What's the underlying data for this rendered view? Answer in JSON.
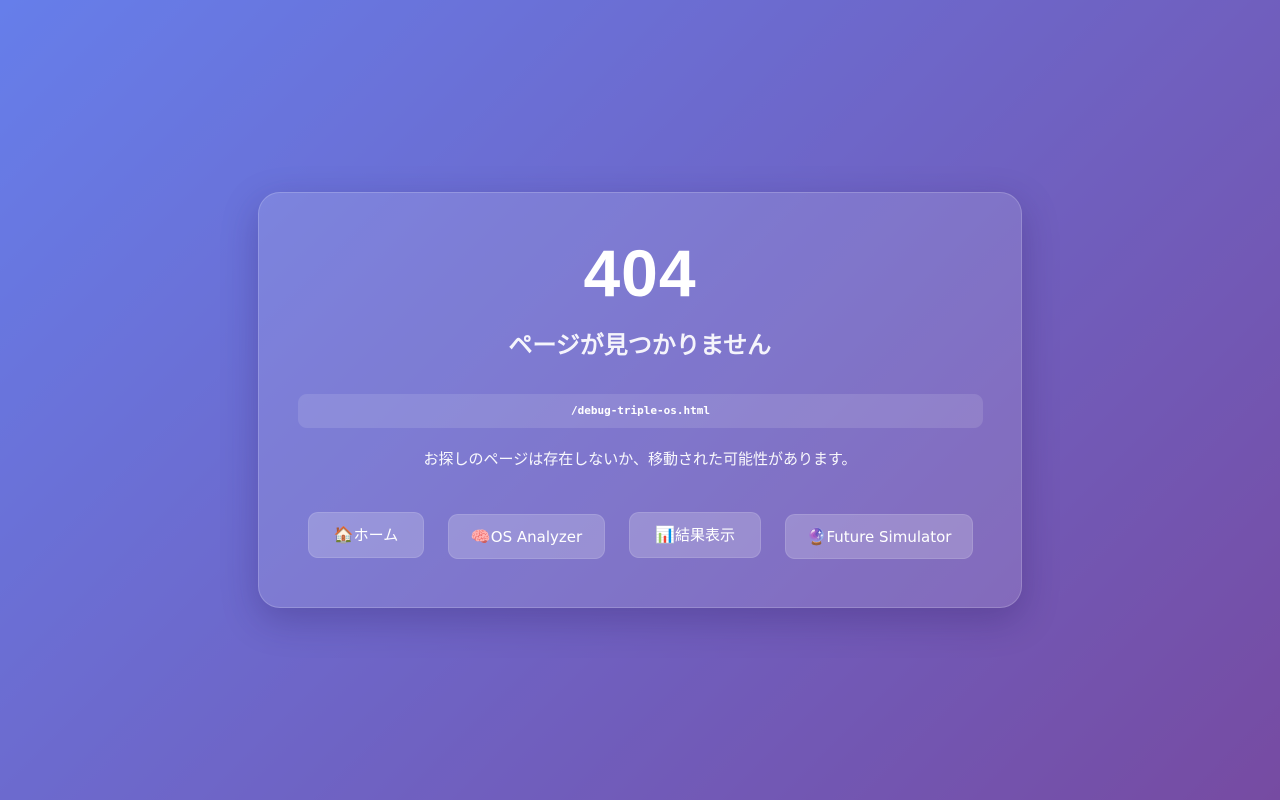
{
  "error": {
    "code": "404",
    "title": "ページが見つかりません",
    "path": "/debug-triple-os.html",
    "message": "お探しのページは存在しないか、移動された可能性があります。"
  },
  "nav": {
    "buttons": [
      {
        "icon": "🏠",
        "icon_name": "house-icon",
        "label": "ホーム"
      },
      {
        "icon": "🧠",
        "icon_name": "brain-icon",
        "label": "OS Analyzer"
      },
      {
        "icon": "📊",
        "icon_name": "bar-chart-icon",
        "label": "結果表示"
      },
      {
        "icon": "🔮",
        "icon_name": "crystal-ball-icon",
        "label": "Future Simulator"
      }
    ]
  },
  "colors": {
    "gradient_start": "#667eea",
    "gradient_end": "#764ba2",
    "text": "#ffffff"
  }
}
